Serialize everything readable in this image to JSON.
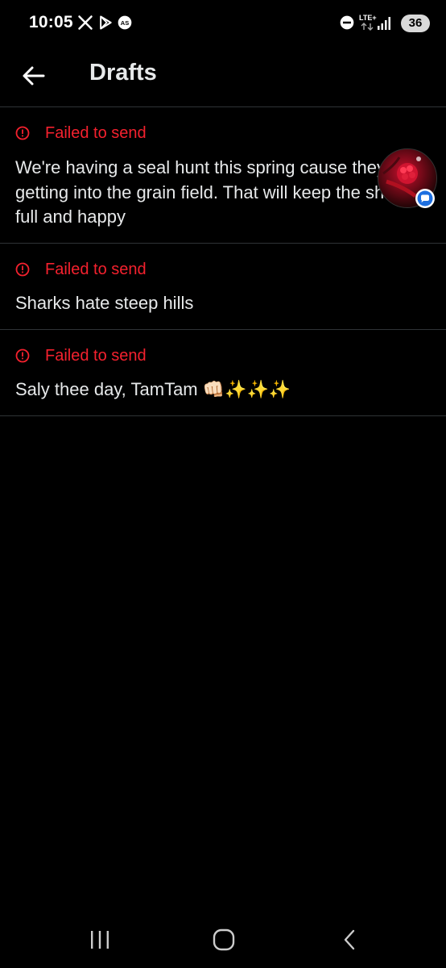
{
  "status_bar": {
    "time": "10:05",
    "battery": "36",
    "network": "LTE+",
    "notification_icons": [
      "x-logo-icon",
      "play-store-icon",
      "as-badge-icon"
    ]
  },
  "header": {
    "title": "Drafts",
    "back_icon": "arrow-left-icon"
  },
  "drafts": [
    {
      "status": "Failed to send",
      "text": "We're having a seal hunt this spring cause they keep getting into the grain field. That will keep the sharks full and happy",
      "has_media": true
    },
    {
      "status": "Failed to send",
      "text": "Sharks hate steep hills"
    },
    {
      "status": "Failed to send",
      "text": "Saly thee day, TamTam 👊🏻✨✨✨"
    }
  ],
  "colors": {
    "background": "#000000",
    "error": "#f4212e",
    "text": "#e7e9ea",
    "divider": "#2f3336"
  }
}
